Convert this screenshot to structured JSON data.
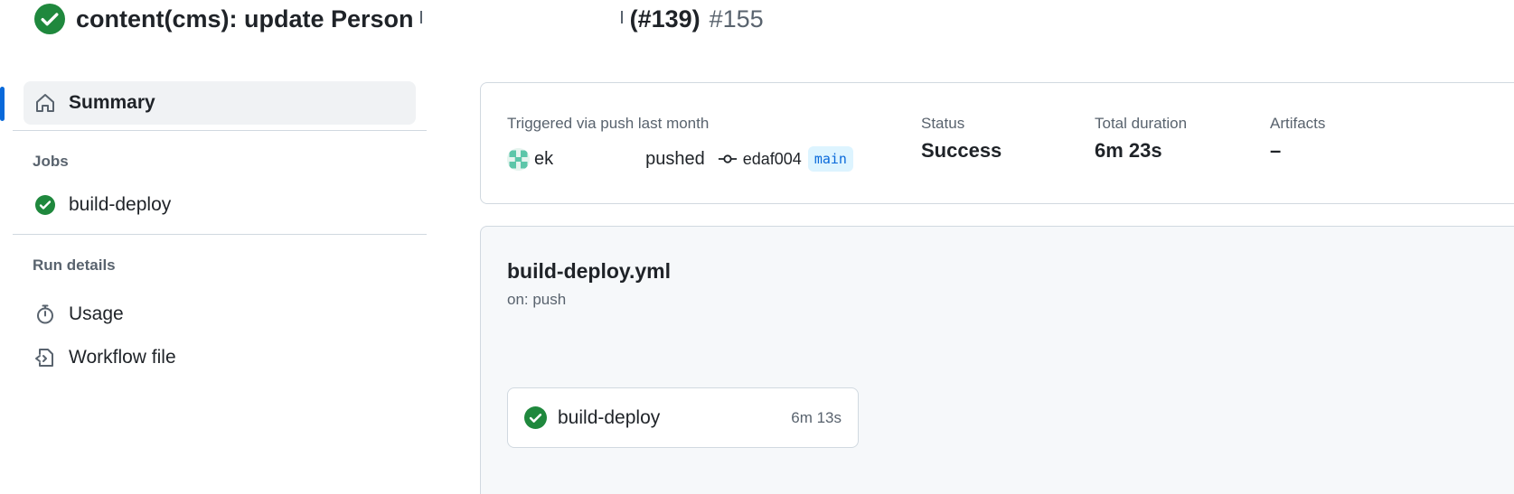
{
  "run": {
    "title_prefix": "content(cms): update Person",
    "title_suffix": "(#139)",
    "run_number": "#155",
    "status_icon": "check-circle-fill-icon"
  },
  "sidebar": {
    "summary_label": "Summary",
    "jobs_heading": "Jobs",
    "jobs": [
      {
        "label": "build-deploy",
        "status": "success"
      }
    ],
    "run_details_heading": "Run details",
    "details": [
      {
        "label": "Usage",
        "icon": "stopwatch-icon"
      },
      {
        "label": "Workflow file",
        "icon": "file-code-icon"
      }
    ]
  },
  "summary": {
    "trigger_label": "Triggered via push last month",
    "actor": "ek",
    "action": "pushed",
    "commit_sha": "edaf004",
    "branch": "main",
    "status_label": "Status",
    "status_value": "Success",
    "duration_label": "Total duration",
    "duration_value": "6m 23s",
    "artifacts_label": "Artifacts",
    "artifacts_value": "–"
  },
  "workflow": {
    "file_name": "build-deploy.yml",
    "trigger": "on: push",
    "jobs": [
      {
        "name": "build-deploy",
        "duration": "6m 13s"
      }
    ]
  },
  "colors": {
    "success": "#1f883d",
    "accent": "#0969da",
    "muted": "#59636e",
    "border": "#d1d9e0"
  }
}
